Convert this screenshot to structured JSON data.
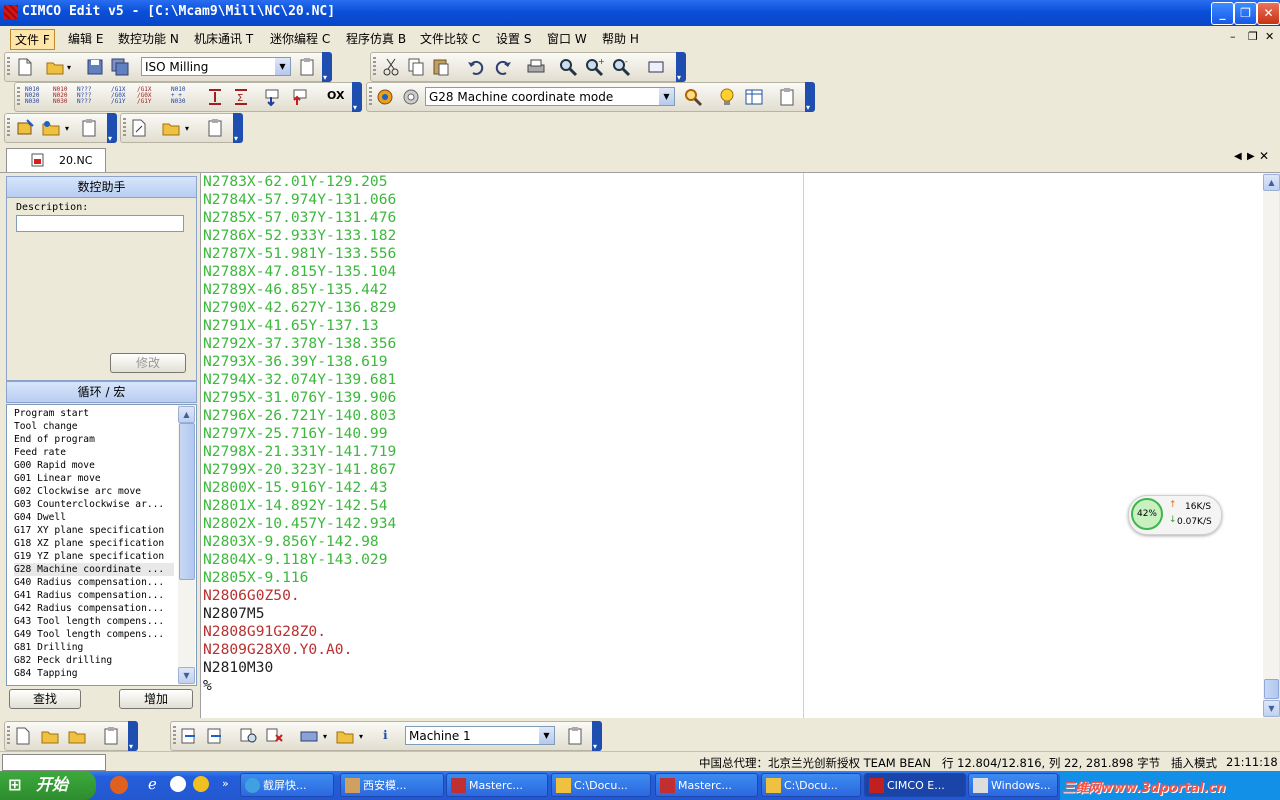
{
  "window": {
    "title": "CIMCO Edit v5 - [C:\\Mcam9\\Mill\\NC\\20.NC]"
  },
  "menu": [
    "文件 F",
    "编辑 E",
    "数控功能 N",
    "机床通讯 T",
    "迷你编程 C",
    "程序仿真 B",
    "文件比较 C",
    "设置 S",
    "窗口 W",
    "帮助 H"
  ],
  "toolbar": {
    "machine_combo": "ISO Milling",
    "mode_combo": "G28 Machine coordinate mode",
    "machine_select": "Machine 1",
    "ox_label": "OX"
  },
  "tabs": {
    "file_tab": "20.NC"
  },
  "assistant": {
    "title": "数控助手",
    "description_label": "Description:",
    "description_value": "",
    "modify_button": "修改"
  },
  "macros": {
    "title": "循环 / 宏",
    "items": [
      "Program start",
      "Tool change",
      "End of program",
      "Feed rate",
      "G00 Rapid move",
      "G01 Linear move",
      "G02 Clockwise arc move",
      "G03 Counterclockwise ar...",
      "G04 Dwell",
      "G17 XY plane specification",
      "G18 XZ plane specification",
      "G19 YZ plane specification",
      "G28 Machine coordinate ...",
      "G40 Radius compensation...",
      "G41 Radius compensation...",
      "G42 Radius compensation...",
      "G43 Tool length compens...",
      "G49 Tool length compens...",
      "G81 Drilling",
      "G82 Peck drilling",
      "G84 Tapping"
    ],
    "selected_index": 12,
    "find_button": "查找",
    "add_button": "增加"
  },
  "editor": {
    "lines": [
      {
        "text": "N2783X-62.01Y-129.205",
        "color": "#3cb83c"
      },
      {
        "text": "N2784X-57.974Y-131.066",
        "color": "#3cb83c"
      },
      {
        "text": "N2785X-57.037Y-131.476",
        "color": "#3cb83c"
      },
      {
        "text": "N2786X-52.933Y-133.182",
        "color": "#3cb83c"
      },
      {
        "text": "N2787X-51.981Y-133.556",
        "color": "#3cb83c"
      },
      {
        "text": "N2788X-47.815Y-135.104",
        "color": "#3cb83c"
      },
      {
        "text": "N2789X-46.85Y-135.442",
        "color": "#3cb83c"
      },
      {
        "text": "N2790X-42.627Y-136.829",
        "color": "#3cb83c"
      },
      {
        "text": "N2791X-41.65Y-137.13",
        "color": "#3cb83c"
      },
      {
        "text": "N2792X-37.378Y-138.356",
        "color": "#3cb83c"
      },
      {
        "text": "N2793X-36.39Y-138.619",
        "color": "#3cb83c"
      },
      {
        "text": "N2794X-32.074Y-139.681",
        "color": "#3cb83c"
      },
      {
        "text": "N2795X-31.076Y-139.906",
        "color": "#3cb83c"
      },
      {
        "text": "N2796X-26.721Y-140.803",
        "color": "#3cb83c"
      },
      {
        "text": "N2797X-25.716Y-140.99",
        "color": "#3cb83c"
      },
      {
        "text": "N2798X-21.331Y-141.719",
        "color": "#3cb83c"
      },
      {
        "text": "N2799X-20.323Y-141.867",
        "color": "#3cb83c"
      },
      {
        "text": "N2800X-15.916Y-142.43",
        "color": "#3cb83c"
      },
      {
        "text": "N2801X-14.892Y-142.54",
        "color": "#3cb83c"
      },
      {
        "text": "N2802X-10.457Y-142.934",
        "color": "#3cb83c"
      },
      {
        "text": "N2803X-9.856Y-142.98",
        "color": "#3cb83c"
      },
      {
        "text": "N2804X-9.118Y-143.029",
        "color": "#3cb83c"
      },
      {
        "text": "N2805X-9.116",
        "color": "#3cb83c"
      },
      {
        "text": "N2806G0Z50.",
        "color": "#b83030"
      },
      {
        "text": "N2807M5",
        "color": "#202020"
      },
      {
        "text": "N2808G91G28Z0.",
        "color": "#b83030"
      },
      {
        "text": "N2809G28X0.Y0.A0.",
        "color": "#b83030"
      },
      {
        "text": "N2810M30",
        "color": "#202020"
      },
      {
        "text": "%",
        "color": "#202020"
      }
    ]
  },
  "network_widget": {
    "percent": "42%",
    "up": "16K/S",
    "down": "0.07K/S"
  },
  "status": {
    "agent": "中国总代理：北京兰光创新授权 TEAM BEAN",
    "position": "行 12.804/12.816, 列 22, 281.898 字节",
    "mode": "插入模式",
    "time": "21:11:18"
  },
  "taskbar": {
    "start": "开始",
    "tasks": [
      "截屏快...",
      "西安模...",
      "Masterc...",
      "C:\\Docu...",
      "Masterc...",
      "C:\\Docu...",
      "CIMCO E...",
      "Windows..."
    ],
    "watermark": "三维网www.3dportal.cn"
  }
}
